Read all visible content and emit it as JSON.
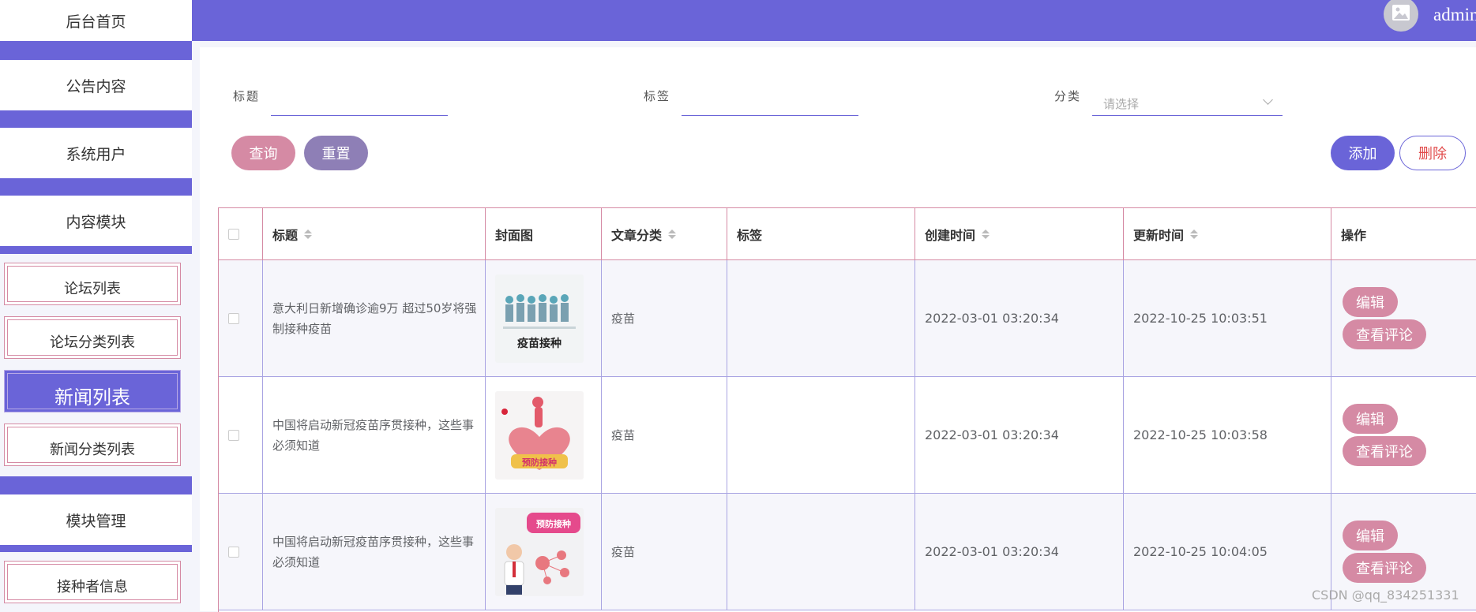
{
  "header": {
    "username": "admin"
  },
  "sidebar": {
    "home": "后台首页",
    "notice": "公告内容",
    "system_user": "系统用户",
    "content_module": "内容模块",
    "sub_items": [
      "论坛列表",
      "论坛分类列表",
      "新闻列表",
      "新闻分类列表"
    ],
    "module_manage": "模块管理",
    "vaccinee_info": "接种者信息"
  },
  "filters": {
    "title_label": "标题",
    "tag_label": "标签",
    "category_label": "分类",
    "category_placeholder": "请选择"
  },
  "buttons": {
    "query": "查询",
    "reset": "重置",
    "add": "添加",
    "delete": "删除"
  },
  "table": {
    "columns": [
      "标题",
      "封面图",
      "文章分类",
      "标签",
      "创建时间",
      "更新时间",
      "操作"
    ],
    "rows": [
      {
        "title": "意大利日新增确诊逾9万 超过50岁将强制接种疫苗",
        "category": "疫苗",
        "tag": "",
        "created": "2022-03-01 03:20:34",
        "updated": "2022-10-25 10:03:51"
      },
      {
        "title": "中国将启动新冠疫苗序贯接种，这些事必须知道",
        "category": "疫苗",
        "tag": "",
        "created": "2022-03-01 03:20:34",
        "updated": "2022-10-25 10:03:58"
      },
      {
        "title": "中国将启动新冠疫苗序贯接种，这些事必须知道",
        "category": "疫苗",
        "tag": "",
        "created": "2022-03-01 03:20:34",
        "updated": "2022-10-25 10:04:05"
      }
    ],
    "row_actions": {
      "edit": "编辑",
      "view_comments": "查看评论"
    }
  },
  "watermark": "CSDN @qq_834251331",
  "colors": {
    "primary": "#6a64d8",
    "accent": "#d58aa4",
    "reset": "#8e7fb6",
    "danger": "#e14b4b"
  }
}
